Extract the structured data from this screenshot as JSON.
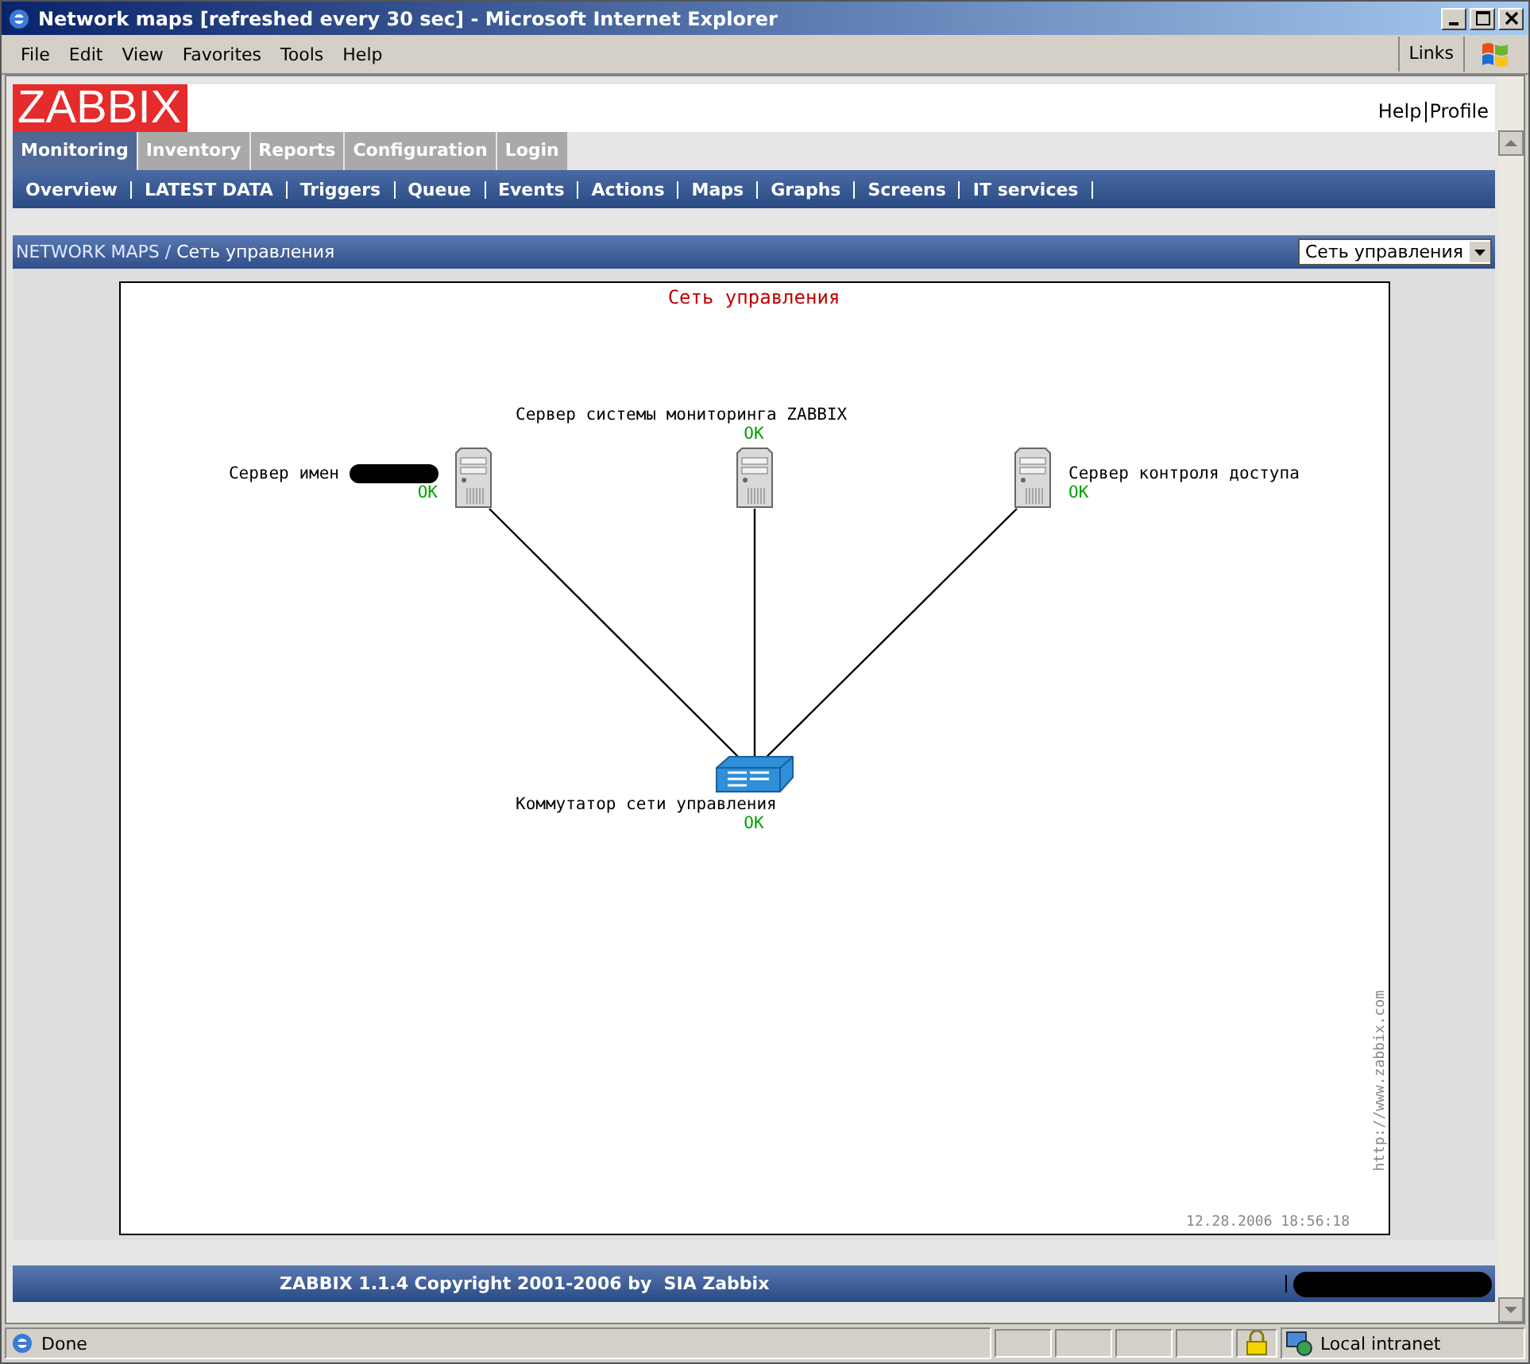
{
  "window": {
    "title": "Network maps [refreshed every 30 sec] - Microsoft Internet Explorer"
  },
  "menu": [
    "File",
    "Edit",
    "View",
    "Favorites",
    "Tools",
    "Help"
  ],
  "links_label": "Links",
  "logo": "ZABBIX",
  "header_links": [
    "Help",
    "Profile"
  ],
  "tabs": [
    {
      "label": "Monitoring",
      "selected": true
    },
    {
      "label": "Inventory",
      "selected": false
    },
    {
      "label": "Reports",
      "selected": false
    },
    {
      "label": "Configuration",
      "selected": false
    },
    {
      "label": "Login",
      "selected": false
    }
  ],
  "submenu": [
    "Overview",
    "LATEST DATA",
    "Triggers",
    "Queue",
    "Events",
    "Actions",
    "Maps",
    "Graphs",
    "Screens",
    "IT services"
  ],
  "breadcrumb": {
    "section": "NETWORK MAPS",
    "separator": "/",
    "current": "Сеть управления"
  },
  "map_select": {
    "value": "Сеть управления"
  },
  "map": {
    "title": "Сеть управления",
    "nodes": [
      {
        "kind": "server",
        "label": "Сервер имен",
        "status": "OK",
        "redacted": true
      },
      {
        "kind": "server",
        "label": "Сервер системы мониторинга ZABBIX",
        "status": "OK",
        "redacted": false
      },
      {
        "kind": "server",
        "label": "Сервер контроля доступа",
        "status": "OK",
        "redacted": false
      },
      {
        "kind": "switch",
        "label": "Коммутатор сети управления",
        "status": "OK",
        "redacted": false
      }
    ],
    "url": "http://www.zabbix.com",
    "timestamp": "12.28.2006 18:56:18"
  },
  "footer": {
    "copyright": "ZABBIX 1.1.4 Copyright 2001-2006 by  SIA Zabbix",
    "redacted": true
  },
  "status_bar": {
    "text": "Done",
    "zone": "Local intranet"
  }
}
